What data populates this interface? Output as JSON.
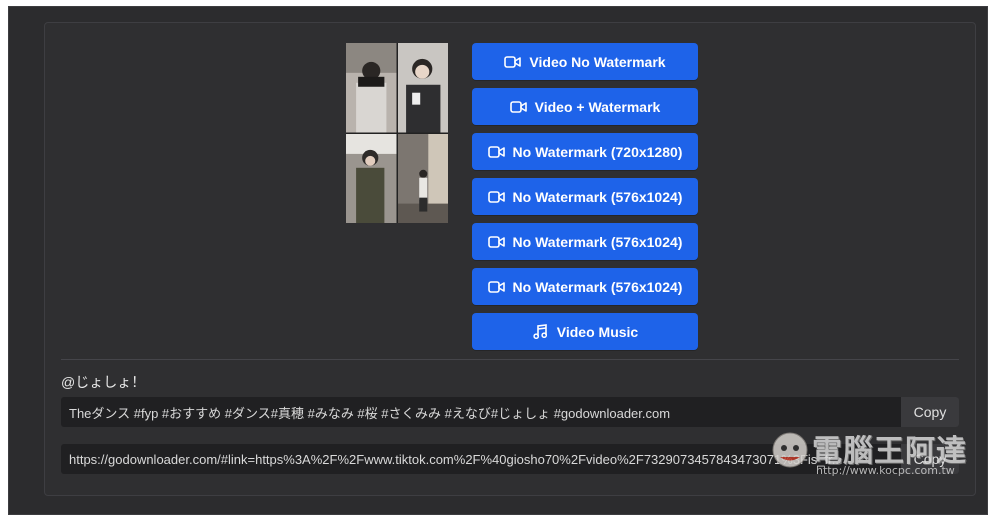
{
  "buttons": [
    {
      "label": "Video No Watermark",
      "icon": "video-icon"
    },
    {
      "label": "Video + Watermark",
      "icon": "video-icon"
    },
    {
      "label": "No Watermark (720x1280)",
      "icon": "video-icon"
    },
    {
      "label": "No Watermark (576x1024)",
      "icon": "video-icon"
    },
    {
      "label": "No Watermark (576x1024)",
      "icon": "video-icon"
    },
    {
      "label": "No Watermark (576x1024)",
      "icon": "video-icon"
    },
    {
      "label": "Video Music",
      "icon": "music-note-icon"
    }
  ],
  "author": "@じょしょ！",
  "caption": {
    "text": "Theダンス #fyp #おすすめ #ダンス#真穂 #みなみ #桜 #さくみみ #えなび#じょしょ #godownloader.com",
    "copy_label": "Copy"
  },
  "link": {
    "text": "https://godownloader.com/#link=https%3A%2F%2Fwww.tiktok.com%2F%40giosho70%2Fvideo%2F7329073457843473071%3Fis_fr...",
    "copy_label": "Copy"
  },
  "watermark": {
    "title": "電腦王阿達",
    "url": "http://www.kocpc.com.tw"
  },
  "colors": {
    "accent": "#1e63e9",
    "background": "#2c2c2e"
  }
}
